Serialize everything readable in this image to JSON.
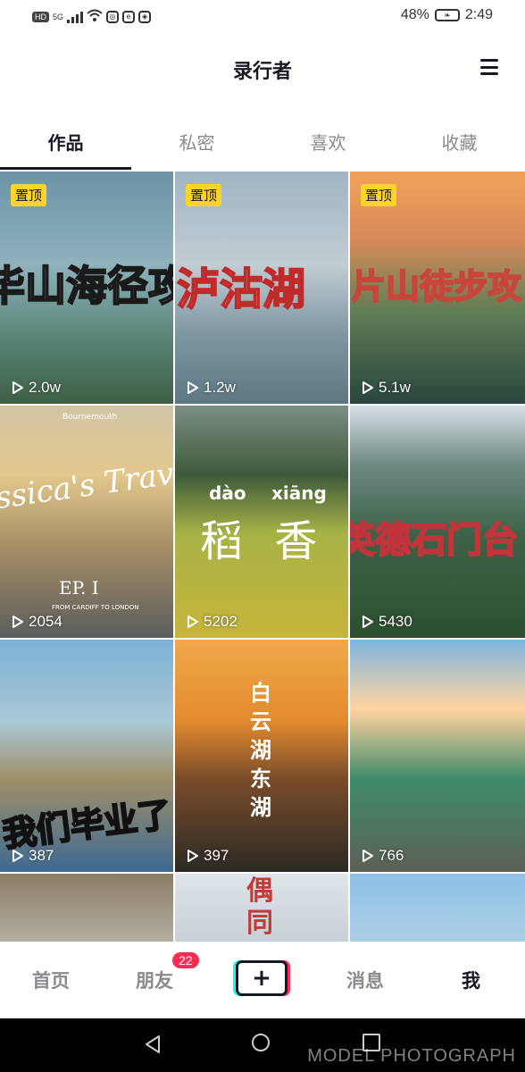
{
  "status_bar": {
    "left_chips": [
      "HD",
      "5G"
    ],
    "battery": "48%",
    "time": "2:49"
  },
  "header": {
    "title": "录行者",
    "menu_icon": "hamburger-menu-icon"
  },
  "tabs": [
    {
      "label": "作品",
      "active": true
    },
    {
      "label": "私密",
      "active": false
    },
    {
      "label": "喜欢",
      "active": false
    },
    {
      "label": "收藏",
      "active": false
    }
  ],
  "videos": [
    {
      "pinned": "置顶",
      "plays": "2.0w",
      "caption": "毕山海径攻"
    },
    {
      "pinned": "置顶",
      "plays": "1.2w",
      "caption": "泸沽湖"
    },
    {
      "pinned": "置顶",
      "plays": "5.1w",
      "caption": "片山徒步攻"
    },
    {
      "pinned": "",
      "plays": "2054",
      "caption": "ssica's Travel v",
      "sub_a": "EP. I",
      "sub_b": "FROM CARDIFF TO LONDON",
      "sub_c": "Bournemouth"
    },
    {
      "pinned": "",
      "plays": "5202",
      "caption": "稻 香",
      "sub_a": "dào",
      "sub_b": "xiāng"
    },
    {
      "pinned": "",
      "plays": "5430",
      "caption": "英德石门台"
    },
    {
      "pinned": "",
      "plays": "387",
      "caption": "我们毕业了"
    },
    {
      "pinned": "",
      "plays": "397",
      "caption": "白云湖东湖"
    },
    {
      "pinned": "",
      "plays": "766",
      "caption": ""
    },
    {
      "pinned": "",
      "plays": "",
      "caption": ""
    },
    {
      "pinned": "",
      "plays": "",
      "caption": "偶 同"
    },
    {
      "pinned": "",
      "plays": "",
      "caption": ""
    }
  ],
  "bottom_nav": {
    "home": "首页",
    "friends": "朋友",
    "friends_badge": "22",
    "create": "+",
    "messages": "消息",
    "me": "我"
  },
  "watermark": "MODEL PHOTOGRAPH",
  "colors": {
    "pin_bg": "#fed32c",
    "badge_bg": "#fe2c55",
    "accent_cyan": "#25f4ee",
    "text_primary": "#161823",
    "text_secondary": "#8a8b91"
  }
}
